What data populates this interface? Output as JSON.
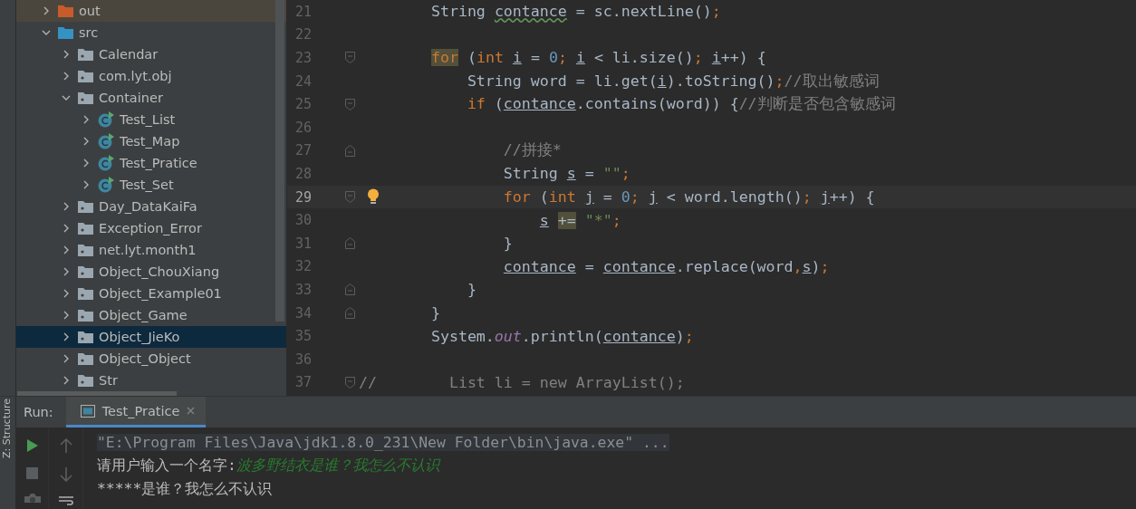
{
  "project_tree": [
    {
      "label": "out",
      "kind": "excluded",
      "expanded": false,
      "selected": false
    },
    {
      "label": "src",
      "kind": "source-root",
      "expanded": true,
      "selected": false,
      "children": [
        {
          "label": "Calendar",
          "kind": "package",
          "expanded": false,
          "selected": false
        },
        {
          "label": "com.lyt.obj",
          "kind": "package",
          "expanded": false,
          "selected": false
        },
        {
          "label": "Container",
          "kind": "package",
          "expanded": true,
          "selected": false,
          "children": [
            {
              "label": "Test_List",
              "kind": "class",
              "expanded": false,
              "selected": false
            },
            {
              "label": "Test_Map",
              "kind": "class",
              "expanded": false,
              "selected": false
            },
            {
              "label": "Test_Pratice",
              "kind": "class",
              "expanded": false,
              "selected": false
            },
            {
              "label": "Test_Set",
              "kind": "class",
              "expanded": false,
              "selected": false
            }
          ]
        },
        {
          "label": "Day_DataKaiFa",
          "kind": "package",
          "expanded": false,
          "selected": false
        },
        {
          "label": "Exception_Error",
          "kind": "package",
          "expanded": false,
          "selected": false
        },
        {
          "label": "net.lyt.month1",
          "kind": "package",
          "expanded": false,
          "selected": false
        },
        {
          "label": "Object_ChouXiang",
          "kind": "package",
          "expanded": false,
          "selected": false
        },
        {
          "label": "Object_Example01",
          "kind": "package",
          "expanded": false,
          "selected": false
        },
        {
          "label": "Object_Game",
          "kind": "package",
          "expanded": false,
          "selected": false
        },
        {
          "label": "Object_JieKo",
          "kind": "package",
          "expanded": false,
          "selected": true
        },
        {
          "label": "Object_Object",
          "kind": "package",
          "expanded": false,
          "selected": false
        },
        {
          "label": "Str",
          "kind": "package",
          "expanded": false,
          "selected": false
        }
      ]
    }
  ],
  "editor": {
    "lines": [
      {
        "number": "21",
        "current": false,
        "fold_start": false,
        "fold_end": false,
        "tokens": [
          {
            "text": "        String",
            "kind": "plain"
          },
          {
            "text": " contance",
            "kind": "squiggle"
          },
          {
            "text": " = sc.nextLine()",
            "kind": "plain"
          },
          {
            "text": ";",
            "kind": "punct"
          }
        ]
      },
      {
        "number": "22",
        "current": false,
        "fold_start": false,
        "fold_end": false
      },
      {
        "number": "23",
        "current": false,
        "fold_start": true,
        "fold_end": false,
        "tokens": [
          {
            "text": "        for",
            "kind": "keyword-match"
          },
          {
            "text": " (",
            "kind": "plain"
          },
          {
            "text": "int",
            "kind": "keyword"
          },
          {
            "text": " i",
            "kind": "var"
          },
          {
            "text": " = ",
            "kind": "plain"
          },
          {
            "text": "0",
            "kind": "number"
          },
          {
            "text": ";",
            "kind": "punct"
          },
          {
            "text": " i",
            "kind": "var"
          },
          {
            "text": " < li.size()",
            "kind": "plain"
          },
          {
            "text": ";",
            "kind": "punct"
          },
          {
            "text": " i",
            "kind": "var"
          },
          {
            "text": "++) {",
            "kind": "plain"
          }
        ]
      },
      {
        "number": "24",
        "current": false,
        "fold_start": false,
        "fold_end": false,
        "tokens": [
          {
            "text": "            String word = li.get(",
            "kind": "plain"
          },
          {
            "text": "i",
            "kind": "var"
          },
          {
            "text": ").toString()",
            "kind": "plain"
          },
          {
            "text": ";",
            "kind": "punct"
          },
          {
            "text": "//取出敏感词",
            "kind": "comment"
          }
        ]
      },
      {
        "number": "25",
        "current": false,
        "fold_start": true,
        "fold_end": false,
        "tokens": [
          {
            "text": "            if",
            "kind": "keyword"
          },
          {
            "text": " (",
            "kind": "plain"
          },
          {
            "text": "contance",
            "kind": "var"
          },
          {
            "text": ".contains(word)) {",
            "kind": "plain"
          },
          {
            "text": "//判断是否包含敏感词",
            "kind": "comment"
          }
        ]
      },
      {
        "number": "26",
        "current": false,
        "fold_start": false,
        "fold_end": false
      },
      {
        "number": "27",
        "current": false,
        "fold_start": false,
        "fold_end": true,
        "tokens": [
          {
            "text": "                //拼接*",
            "kind": "comment"
          }
        ]
      },
      {
        "number": "28",
        "current": false,
        "fold_start": false,
        "fold_end": false,
        "tokens": [
          {
            "text": "                String",
            "kind": "plain"
          },
          {
            "text": " s",
            "kind": "var"
          },
          {
            "text": " = ",
            "kind": "plain"
          },
          {
            "text": "\"\"",
            "kind": "string"
          },
          {
            "text": ";",
            "kind": "punct"
          }
        ]
      },
      {
        "number": "29",
        "current": true,
        "fold_start": true,
        "fold_end": false,
        "bulb": true,
        "tokens": [
          {
            "text": "                for",
            "kind": "keyword"
          },
          {
            "text": " (",
            "kind": "plain"
          },
          {
            "text": "int",
            "kind": "keyword"
          },
          {
            "text": " j",
            "kind": "var"
          },
          {
            "text": " = ",
            "kind": "plain"
          },
          {
            "text": "0",
            "kind": "number"
          },
          {
            "text": ";",
            "kind": "punct"
          },
          {
            "text": " j",
            "kind": "var"
          },
          {
            "text": " < word.length()",
            "kind": "plain"
          },
          {
            "text": ";",
            "kind": "punct"
          },
          {
            "text": " j",
            "kind": "var"
          },
          {
            "text": "++) {",
            "kind": "plain"
          }
        ]
      },
      {
        "number": "30",
        "current": false,
        "fold_start": false,
        "fold_end": false,
        "tokens": [
          {
            "text": "                    s",
            "kind": "var"
          },
          {
            "text": " +=",
            "kind": "match"
          },
          {
            "text": " \"*\"",
            "kind": "string"
          },
          {
            "text": ";",
            "kind": "punct"
          }
        ]
      },
      {
        "number": "31",
        "current": false,
        "fold_start": false,
        "fold_end": true,
        "tokens": [
          {
            "text": "                }",
            "kind": "plain"
          }
        ]
      },
      {
        "number": "32",
        "current": false,
        "fold_start": false,
        "fold_end": false,
        "tokens": [
          {
            "text": "                contance",
            "kind": "var"
          },
          {
            "text": " = ",
            "kind": "plain"
          },
          {
            "text": "contance",
            "kind": "var"
          },
          {
            "text": ".replace(word",
            "kind": "plain"
          },
          {
            "text": ",",
            "kind": "punct"
          },
          {
            "text": "s",
            "kind": "var"
          },
          {
            "text": ")",
            "kind": "plain"
          },
          {
            "text": ";",
            "kind": "punct"
          }
        ]
      },
      {
        "number": "33",
        "current": false,
        "fold_start": false,
        "fold_end": true,
        "tokens": [
          {
            "text": "            }",
            "kind": "plain"
          }
        ]
      },
      {
        "number": "34",
        "current": false,
        "fold_start": false,
        "fold_end": true,
        "tokens": [
          {
            "text": "        }",
            "kind": "plain"
          }
        ]
      },
      {
        "number": "35",
        "current": false,
        "fold_start": false,
        "fold_end": false,
        "tokens": [
          {
            "text": "        System.",
            "kind": "plain"
          },
          {
            "text": "out",
            "kind": "field"
          },
          {
            "text": ".println(",
            "kind": "plain"
          },
          {
            "text": "contance",
            "kind": "var"
          },
          {
            "text": ")",
            "kind": "plain"
          },
          {
            "text": ";",
            "kind": "punct"
          }
        ]
      },
      {
        "number": "36",
        "current": false,
        "fold_start": false,
        "fold_end": false
      },
      {
        "number": "37",
        "current": false,
        "fold_start": true,
        "fold_end": false,
        "tokens": [
          {
            "text": "//        List li = new ArrayList();",
            "kind": "comment"
          }
        ]
      }
    ]
  },
  "run_panel": {
    "side_label": "Z: Structure",
    "title": "Run:",
    "tabs": [
      {
        "label": "Test_Pratice",
        "selected": true
      }
    ],
    "console": [
      [
        {
          "text": "\"E:\\Program Files\\Java\\jdk1.8.0_231\\New Folder\\bin\\java.exe\" ...",
          "kind": "command"
        }
      ],
      [
        {
          "text": "请用户输入一个名字:",
          "kind": "output"
        },
        {
          "text": "波多野结衣是谁？我怎么不认识",
          "kind": "input"
        }
      ],
      [
        {
          "text": "*****是谁？我怎么不认识",
          "kind": "output"
        }
      ]
    ]
  }
}
